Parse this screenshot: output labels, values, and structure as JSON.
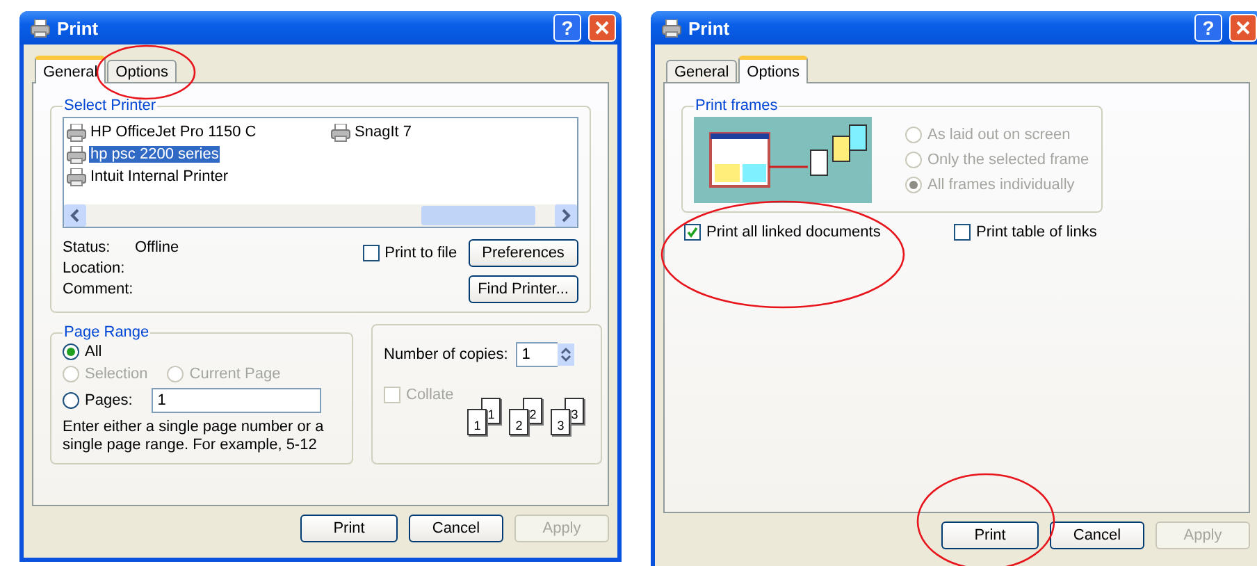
{
  "dialogs": [
    {
      "kind": "general",
      "title": "Print",
      "help": "?",
      "tabs": [
        {
          "label": "General",
          "selected": true,
          "circled": false
        },
        {
          "label": "Options",
          "selected": false,
          "circled": true
        }
      ],
      "select_printer": {
        "title": "Select Printer",
        "printers": [
          {
            "name": "HP OfficeJet Pro 1150 C",
            "selected": false
          },
          {
            "name": "hp psc 2200 series",
            "selected": true
          },
          {
            "name": "Intuit Internal Printer",
            "selected": false
          },
          {
            "name": "SnagIt 7",
            "selected": false
          }
        ],
        "info": [
          {
            "label": "Status:",
            "value": "Offline"
          },
          {
            "label": "Location:"
          },
          {
            "label": "Comment:"
          }
        ],
        "print_to_file": {
          "label": "Print to file",
          "checked": false
        },
        "actions": [
          "Preferences",
          "Find Printer..."
        ]
      },
      "page_range": {
        "title": "Page Range",
        "options": [
          {
            "label": "All",
            "selected": true,
            "disabled": false
          },
          {
            "label": "Selection",
            "selected": false,
            "disabled": true
          },
          {
            "label": "Current Page",
            "selected": false,
            "disabled": true
          },
          {
            "label": "Pages:",
            "selected": false,
            "disabled": false
          }
        ],
        "pages_value": "1",
        "hint": "Enter either a single page number or a single page range.  For example, 5-12"
      },
      "copies": {
        "label": "Number of copies:",
        "value": "1",
        "collate": {
          "label": "Collate",
          "checked": false,
          "disabled": true
        },
        "sets": [
          [
            "1",
            "1"
          ],
          [
            "2",
            "2"
          ],
          [
            "3",
            "3"
          ]
        ]
      },
      "buttons": [
        {
          "label": "Print",
          "disabled": false,
          "circled": false
        },
        {
          "label": "Cancel",
          "disabled": false,
          "circled": false
        },
        {
          "label": "Apply",
          "disabled": true,
          "circled": false
        }
      ]
    },
    {
      "kind": "options",
      "title": "Print",
      "help": "?",
      "tabs": [
        {
          "label": "General",
          "selected": false,
          "circled": false
        },
        {
          "label": "Options",
          "selected": true,
          "circled": false
        }
      ],
      "print_frames": {
        "title": "Print frames",
        "options": [
          {
            "label": "As laid out on screen",
            "selected": false,
            "disabled": true
          },
          {
            "label": "Only the selected frame",
            "selected": false,
            "disabled": true
          },
          {
            "label": "All frames individually",
            "selected": true,
            "disabled": true
          }
        ]
      },
      "checkboxes": [
        {
          "label": "Print all linked documents",
          "checked": true,
          "circled": true
        },
        {
          "label": "Print table of links",
          "checked": false,
          "circled": false
        }
      ],
      "buttons": [
        {
          "label": "Print",
          "disabled": false,
          "circled": true
        },
        {
          "label": "Cancel",
          "disabled": false,
          "circled": false
        },
        {
          "label": "Apply",
          "disabled": true,
          "circled": false
        }
      ]
    }
  ]
}
